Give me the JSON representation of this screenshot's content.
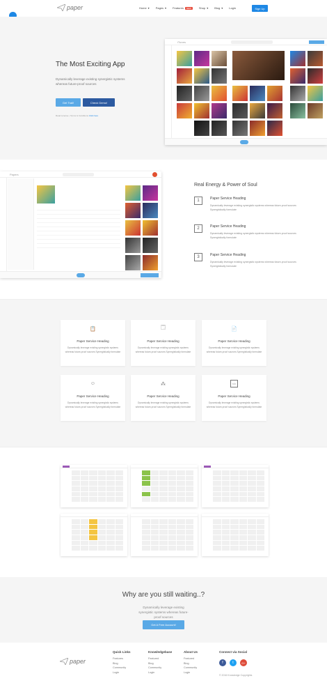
{
  "nav": {
    "logo": "paper",
    "items": [
      {
        "label": "Home",
        "caret": "▾"
      },
      {
        "label": "Pages",
        "caret": "▾"
      },
      {
        "label": "Features",
        "badge": "NEW"
      },
      {
        "label": "Shop",
        "caret": "▾"
      },
      {
        "label": "Blog",
        "caret": "▾"
      },
      {
        "label": "Login"
      }
    ],
    "signup": "Sign Up"
  },
  "hero": {
    "title": "The Most Exciting App",
    "subtitle": "Dynamically leverage existing synergistic systems whereas future-proof sources",
    "trial_btn": "Get Trail!",
    "demo_btn": "Check Demo!",
    "note": "Read License • Terms & Conditions",
    "note_link": "Click here",
    "mock_title": "iTunes"
  },
  "section2": {
    "title": "Real Energy & Power of Soul",
    "mock_title": "Papers",
    "features": [
      {
        "num": "1",
        "heading": "Paper Service Heading",
        "desc": "Dynamically leverage existing synergistic systems whereas future-proof sources Synergistically formulate"
      },
      {
        "num": "2",
        "heading": "Paper Service Heading",
        "desc": "Dynamically leverage existing synergistic systems whereas future-proof sources Synergistically formulate"
      },
      {
        "num": "3",
        "heading": "Paper Service Heading",
        "desc": "Dynamically leverage existing synergistic systems whereas future-proof sources Synergistically formulate"
      }
    ]
  },
  "services": [
    {
      "icon": "clipboard-icon",
      "glyph": "📋",
      "heading": "Paper Service Heading",
      "desc": "Dynamically leverage existing synergistic systems whereas future-proof sources Synergistically formulate"
    },
    {
      "icon": "browser-icon",
      "glyph": "🗔",
      "heading": "Paper Service Heading",
      "desc": "Dynamically leverage existing synergistic systems whereas future-proof sources Synergistically formulate"
    },
    {
      "icon": "document-icon",
      "glyph": "📄",
      "heading": "Paper Service Heading",
      "desc": "Dynamically leverage existing synergistic systems whereas future-proof sources Synergistically formulate"
    },
    {
      "icon": "smiley-icon",
      "glyph": "☺",
      "heading": "Paper Service Heading",
      "desc": "Dynamically leverage existing synergistic systems whereas future-proof sources Synergistically formulate"
    },
    {
      "icon": "pattern-icon",
      "glyph": "⁂",
      "heading": "Paper Service Heading",
      "desc": "Dynamically leverage existing synergistic systems whereas future-proof sources Synergistically formulate"
    },
    {
      "icon": "code-icon",
      "glyph": "</>",
      "heading": "Paper Service Heading",
      "desc": "Dynamically leverage existing synergistic systems whereas future-proof sources Synergistically formulate"
    }
  ],
  "cta": {
    "title": "Why are you still waiting..?",
    "subtitle": "Dynamically leverage existing synergistic systems whereas future-proof sources",
    "button": "Get A Free Account!"
  },
  "footer": {
    "logo": "paper",
    "columns": [
      {
        "heading": "Quick Links",
        "items": [
          "Features",
          "Blog",
          "Community",
          "Login"
        ]
      },
      {
        "heading": "Knowledgebase",
        "items": [
          "Featured",
          "Blog",
          "Community",
          "Login"
        ]
      },
      {
        "heading": "About Us",
        "items": [
          "Featured",
          "Blog",
          "Community",
          "Login"
        ]
      }
    ],
    "social_heading": "Connect via Social",
    "social": [
      {
        "icon": "facebook-icon",
        "glyph": "f",
        "color": "#3b5998"
      },
      {
        "icon": "twitter-icon",
        "glyph": "t",
        "color": "#1da1f2"
      },
      {
        "icon": "googleplus-icon",
        "glyph": "G+",
        "color": "#dd4b39"
      }
    ],
    "copyright": "© 2016 Knowledge Copyrights"
  },
  "colors": {
    "primary": "#1e88e5",
    "trial": "#5aa9e6",
    "demo": "#2c5aa0"
  }
}
